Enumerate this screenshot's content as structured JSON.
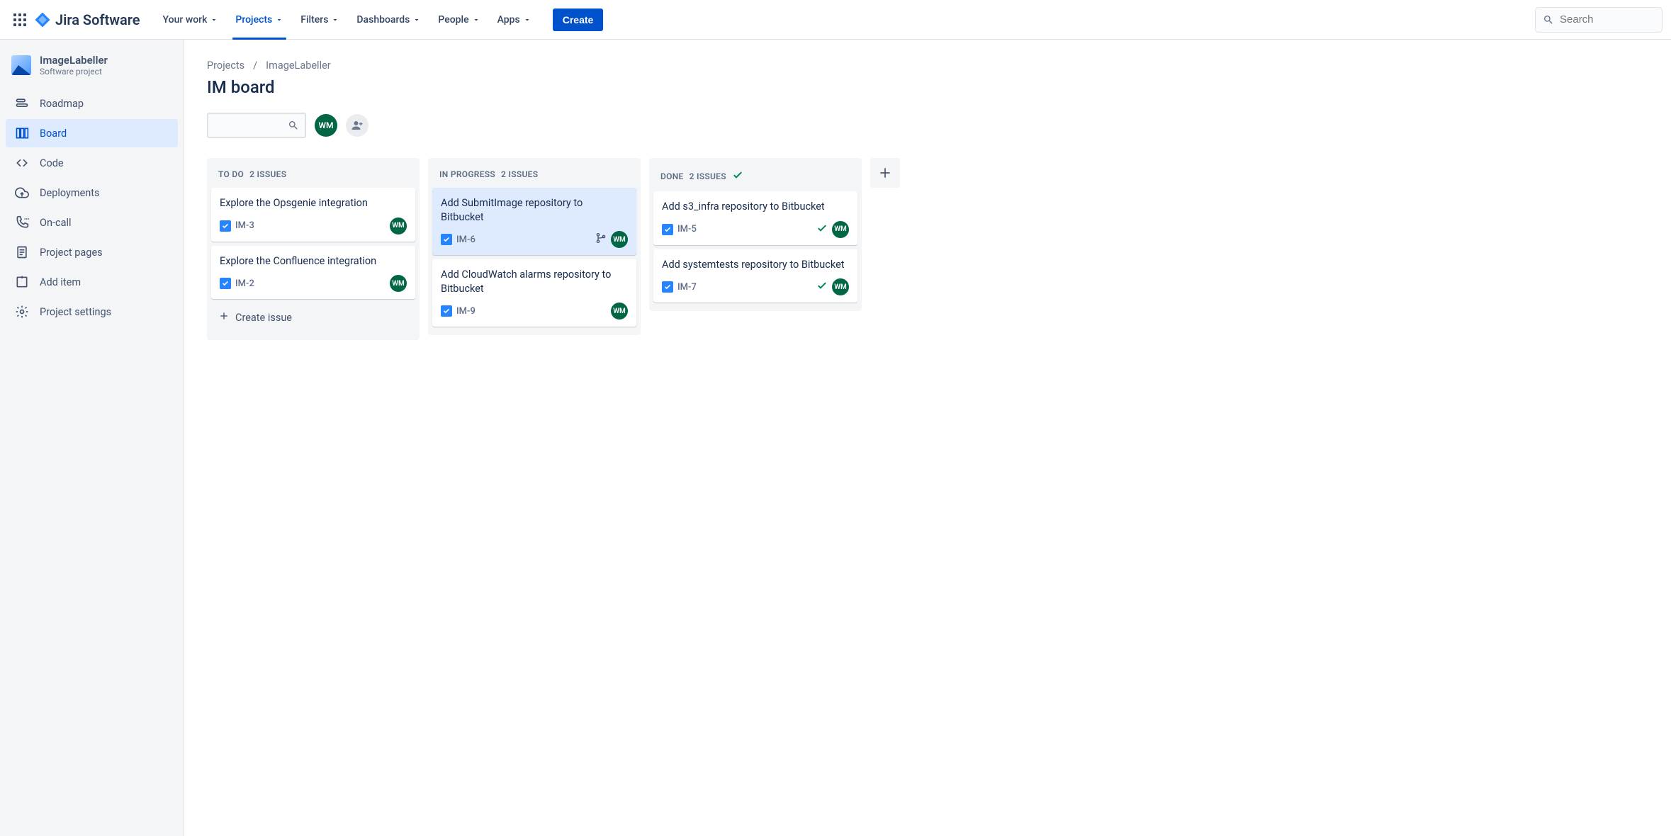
{
  "brand": {
    "name": "Jira Software"
  },
  "nav": {
    "items": [
      {
        "label": "Your work"
      },
      {
        "label": "Projects"
      },
      {
        "label": "Filters"
      },
      {
        "label": "Dashboards"
      },
      {
        "label": "People"
      },
      {
        "label": "Apps"
      }
    ],
    "create": "Create",
    "search_placeholder": "Search"
  },
  "project": {
    "name": "ImageLabeller",
    "type": "Software project"
  },
  "sidebar": {
    "items": [
      {
        "label": "Roadmap"
      },
      {
        "label": "Board"
      },
      {
        "label": "Code"
      },
      {
        "label": "Deployments"
      },
      {
        "label": "On-call"
      },
      {
        "label": "Project pages"
      },
      {
        "label": "Add item"
      },
      {
        "label": "Project settings"
      }
    ]
  },
  "breadcrumb": {
    "root": "Projects",
    "current": "ImageLabeller"
  },
  "page": {
    "title": "IM board"
  },
  "assignee": {
    "initials": "WM"
  },
  "columns": [
    {
      "name": "TO DO",
      "count_label": "2 ISSUES",
      "done": false,
      "show_create": true,
      "create_label": "Create issue",
      "cards": [
        {
          "title": "Explore the Opsgenie integration",
          "key": "IM-3",
          "assignee": "WM",
          "selected": false,
          "done": false,
          "branch": false
        },
        {
          "title": "Explore the Confluence integration",
          "key": "IM-2",
          "assignee": "WM",
          "selected": false,
          "done": false,
          "branch": false
        }
      ]
    },
    {
      "name": "IN PROGRESS",
      "count_label": "2 ISSUES",
      "done": false,
      "show_create": false,
      "cards": [
        {
          "title": "Add SubmitImage repository to Bitbucket",
          "key": "IM-6",
          "assignee": "WM",
          "selected": true,
          "done": false,
          "branch": true
        },
        {
          "title": "Add CloudWatch alarms repository to Bitbucket",
          "key": "IM-9",
          "assignee": "WM",
          "selected": false,
          "done": false,
          "branch": false
        }
      ]
    },
    {
      "name": "DONE",
      "count_label": "2 ISSUES",
      "done": true,
      "show_create": false,
      "cards": [
        {
          "title": "Add s3_infra repository to Bitbucket",
          "key": "IM-5",
          "assignee": "WM",
          "selected": false,
          "done": true,
          "branch": false
        },
        {
          "title": "Add systemtests repository to Bitbucket",
          "key": "IM-7",
          "assignee": "WM",
          "selected": false,
          "done": true,
          "branch": false
        }
      ]
    }
  ]
}
